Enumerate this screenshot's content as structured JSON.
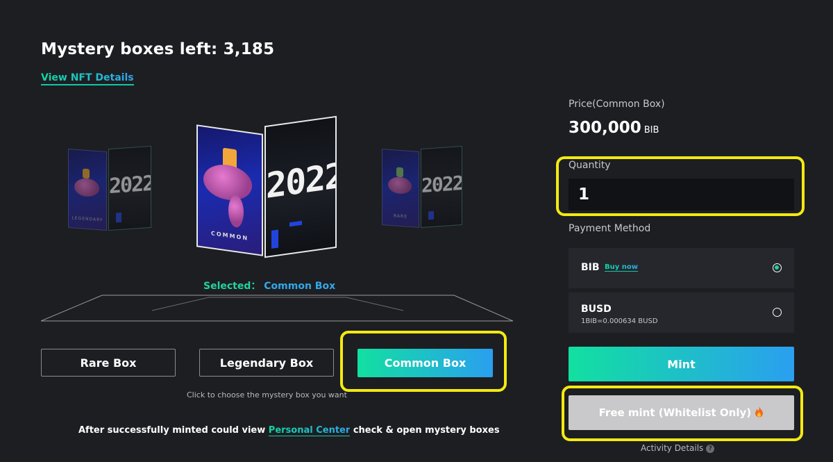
{
  "header": {
    "title": "Mystery boxes left: 3,185",
    "nft_link": "View NFT Details"
  },
  "boxes": {
    "year_text": "2022",
    "left_box_caption": "LEGENDARY",
    "center_box_caption": "COMMON",
    "right_box_caption": "RARE"
  },
  "selection": {
    "label": "Selected：",
    "value": "Common Box"
  },
  "box_buttons": [
    {
      "label": "Rare Box"
    },
    {
      "label": "Legendary Box"
    },
    {
      "label": "Common Box"
    }
  ],
  "hint": "Click to choose the mystery box you want",
  "footer": {
    "prefix": "After successfully minted could view ",
    "link": "Personal Center",
    "suffix": " check & open mystery boxes"
  },
  "panel": {
    "price_label": "Price(Common Box)",
    "price_value": "300,000",
    "price_unit": "BIB",
    "quantity_label": "Quantity",
    "quantity_value": "1",
    "payment_label": "Payment Method",
    "payments": [
      {
        "name": "BIB",
        "extra": "Buy now",
        "selected": true
      },
      {
        "name": "BUSD",
        "extra": "1BIB=0.000634 BUSD",
        "selected": false
      }
    ],
    "mint_label": "Mint",
    "free_mint_label": "Free mint (Whitelist Only)",
    "free_mint_icon": "fire-icon",
    "activity_label": "Activity Details",
    "activity_icon": "question-icon"
  },
  "colors": {
    "background": "#1d1e22",
    "accent_green": "#12e0a0",
    "accent_blue": "#2a9ff0",
    "highlight_yellow": "#f2ea12"
  }
}
